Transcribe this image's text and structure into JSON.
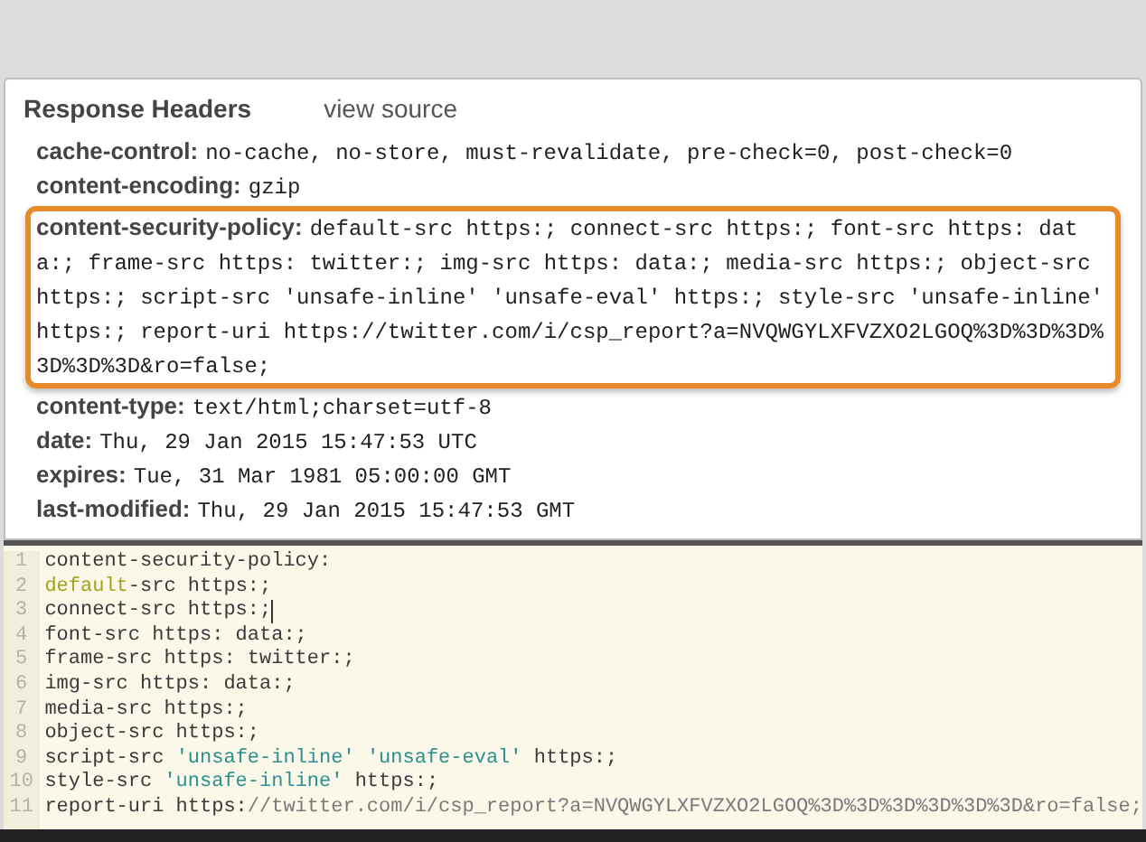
{
  "panel": {
    "title": "Response Headers",
    "link": "view source"
  },
  "headers": [
    {
      "name": "cache-control:",
      "value": "no-cache, no-store, must-revalidate, pre-check=0, post-check=0",
      "highlighted": false
    },
    {
      "name": "content-encoding:",
      "value": "gzip",
      "highlighted": false
    },
    {
      "name": "content-security-policy:",
      "value": "default-src https:; connect-src https:; font-src https: data:; frame-src https: twitter:; img-src https: data:; media-src https:; object-src https:; script-src 'unsafe-inline' 'unsafe-eval' https:; style-src 'unsafe-inline' https:; report-uri https://twitter.com/i/csp_report?a=NVQWGYLXFVZXO2LGOQ%3D%3D%3D%3D%3D%3D&ro=false;",
      "highlighted": true
    },
    {
      "name": "content-type:",
      "value": "text/html;charset=utf-8",
      "highlighted": false
    },
    {
      "name": "date:",
      "value": "Thu, 29 Jan 2015 15:47:53 UTC",
      "highlighted": false
    },
    {
      "name": "expires:",
      "value": "Tue, 31 Mar 1981 05:00:00 GMT",
      "highlighted": false
    },
    {
      "name": "last-modified:",
      "value": "Thu, 29 Jan 2015 15:47:53 GMT",
      "highlighted": false
    }
  ],
  "editor": {
    "lines": [
      {
        "number": "1",
        "cursor": false,
        "segments": [
          {
            "text": "content-security-policy:",
            "kind": "plain"
          }
        ]
      },
      {
        "number": "2",
        "cursor": false,
        "segments": [
          {
            "text": "default",
            "kind": "match"
          },
          {
            "text": "-src https:;",
            "kind": "plain"
          }
        ]
      },
      {
        "number": "3",
        "cursor": true,
        "segments": [
          {
            "text": "connect-src https:;",
            "kind": "plain"
          }
        ]
      },
      {
        "number": "4",
        "cursor": false,
        "segments": [
          {
            "text": "font-src https: data:;",
            "kind": "plain"
          }
        ]
      },
      {
        "number": "5",
        "cursor": false,
        "segments": [
          {
            "text": "frame-src https: twitter:;",
            "kind": "plain"
          }
        ]
      },
      {
        "number": "6",
        "cursor": false,
        "segments": [
          {
            "text": "img-src https: data:;",
            "kind": "plain"
          }
        ]
      },
      {
        "number": "7",
        "cursor": false,
        "segments": [
          {
            "text": "media-src https:;",
            "kind": "plain"
          }
        ]
      },
      {
        "number": "8",
        "cursor": false,
        "segments": [
          {
            "text": "object-src https:;",
            "kind": "plain"
          }
        ]
      },
      {
        "number": "9",
        "cursor": false,
        "segments": [
          {
            "text": "script-src ",
            "kind": "plain"
          },
          {
            "text": "'unsafe-inline' ",
            "kind": "string"
          },
          {
            "text": "'unsafe-eval'",
            "kind": "string"
          },
          {
            "text": " https:;",
            "kind": "plain"
          }
        ]
      },
      {
        "number": "10",
        "cursor": false,
        "segments": [
          {
            "text": "style-src ",
            "kind": "plain"
          },
          {
            "text": "'unsafe-inline'",
            "kind": "string"
          },
          {
            "text": " https:;",
            "kind": "plain"
          }
        ]
      },
      {
        "number": "11",
        "cursor": false,
        "segments": [
          {
            "text": "report-uri https:",
            "kind": "plain"
          },
          {
            "text": "//twitter.com/i/csp_report?a=NVQWGYLXFVZXO2LGOQ%3D%3D%3D%3D%3D%3D&ro=false;",
            "kind": "url"
          }
        ]
      }
    ]
  }
}
